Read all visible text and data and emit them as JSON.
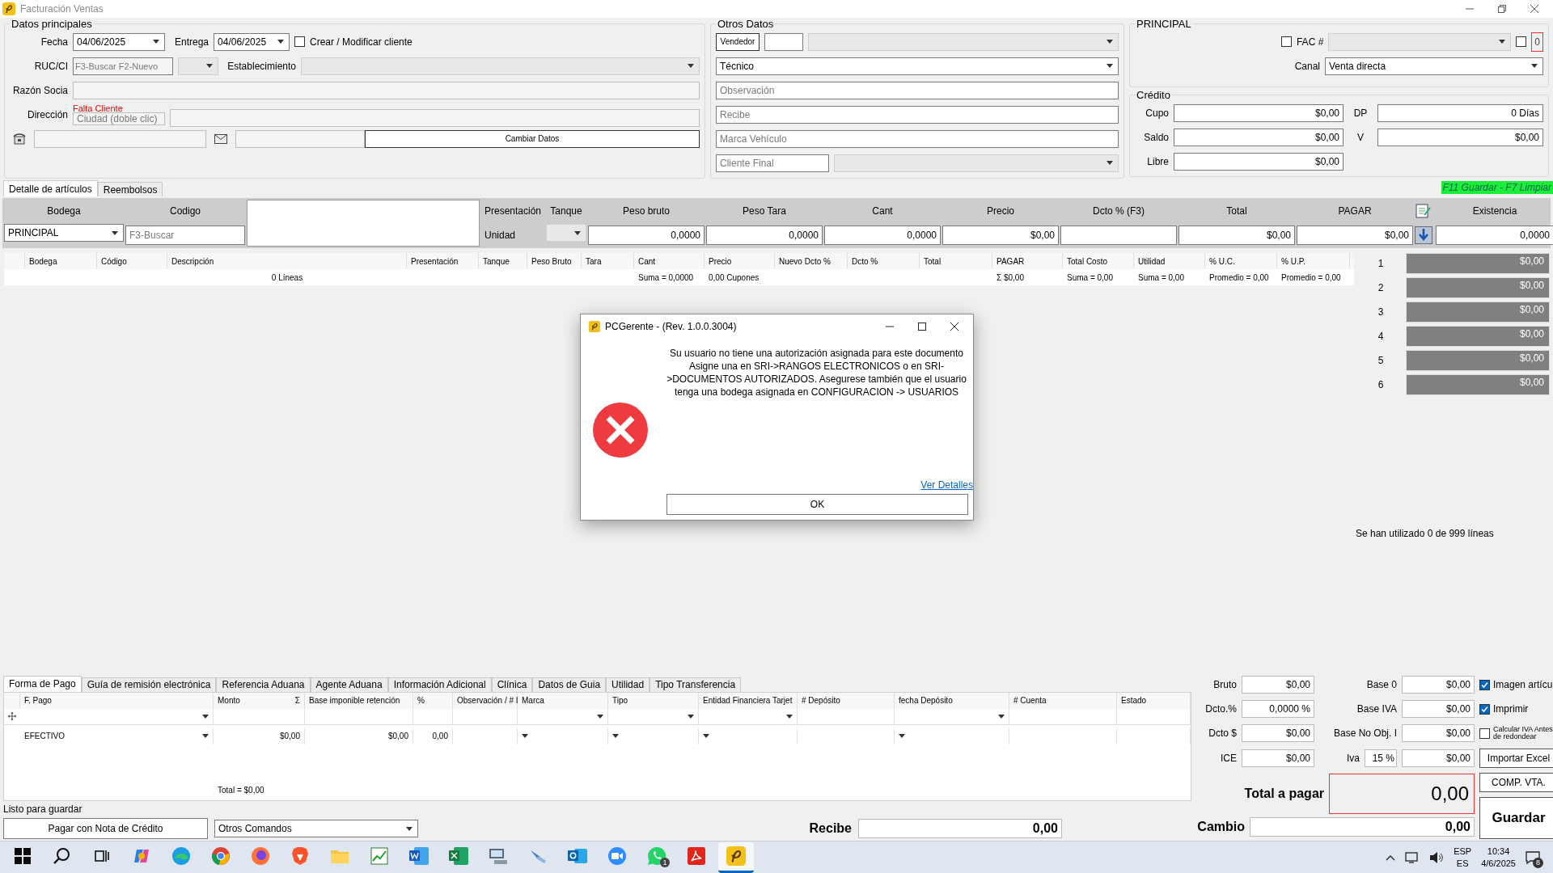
{
  "window": {
    "title": "Facturación Ventas"
  },
  "datos_principales": {
    "title": "Datos principales",
    "fecha_label": "Fecha",
    "fecha": "04/06/2025",
    "entrega_label": "Entrega",
    "entrega": "04/06/2025",
    "crear_cliente": {
      "label": "Crear / Modificar cliente",
      "checked": false
    },
    "ruc_label": "RUC/CI",
    "ruc_placeholder": "F3-Buscar F2-Nuevo",
    "establecimiento_label": "Establecimiento",
    "razon_label": "Razón Socia",
    "direccion_label": "Dirección",
    "warning": "Falta Cliente",
    "ciudad_placeholder": "Ciudad (doble clic)",
    "cambiar_button": "Cambiar Datos"
  },
  "otros_datos": {
    "title": "Otros Datos",
    "vendedor_button": "Vendedor",
    "tecnico": "Técnico",
    "observacion_placeholder": "Observación",
    "recibe_placeholder": "Recibe",
    "marca_placeholder": "Marca Vehículo",
    "cliente_final_placeholder": "Cliente Final"
  },
  "principal": {
    "title": "PRINCIPAL",
    "fac": {
      "label": "FAC #",
      "checked": false
    },
    "extra_checked": false,
    "counter": "0",
    "canal_label": "Canal",
    "canal": "Venta directa"
  },
  "credito": {
    "title": "Crédito",
    "fields": [
      {
        "label": "Cupo",
        "value": "$0,00"
      },
      {
        "label": "DP",
        "value": "0 Días"
      },
      {
        "label": "Saldo",
        "value": "$0,00"
      },
      {
        "label": "V",
        "value": "$0,00"
      },
      {
        "label": "Libre",
        "value": "$0,00"
      }
    ]
  },
  "main_tabs": [
    {
      "label": "Detalle de artículos",
      "selected": true
    },
    {
      "label": "Reembolsos",
      "selected": false
    }
  ],
  "shortcut_hint": "F11 Guardar - F7 Limpiar",
  "entry": [
    {
      "kind": "select",
      "label": "Bodega",
      "value": "PRINCIPAL"
    },
    {
      "kind": "input",
      "label": "Codigo",
      "placeholder": "F3-Buscar"
    },
    {
      "kind": "memo"
    },
    {
      "kind": "text",
      "label": "Presentación",
      "value": "Unidad"
    },
    {
      "kind": "select",
      "label": "Tanque"
    },
    {
      "kind": "input",
      "label": "Peso bruto",
      "value": "0,0000"
    },
    {
      "kind": "input",
      "label": "Peso Tara",
      "value": "0,0000"
    },
    {
      "kind": "input",
      "label": "Cant",
      "value": "0,0000"
    },
    {
      "kind": "input",
      "label": "Precio",
      "value": "$0,00"
    },
    {
      "kind": "input",
      "label": "Dcto % (F3)"
    },
    {
      "kind": "input",
      "label": "Total",
      "value": "$0,00"
    },
    {
      "kind": "input",
      "label": "PAGAR",
      "value": "$0,00"
    },
    {
      "kind": "action"
    },
    {
      "kind": "input",
      "label": "Existencia",
      "value": "0,0000"
    }
  ],
  "items_grid": {
    "columns": [
      "Bodega",
      "Código",
      "Descripción",
      "Presentación",
      "Tanque",
      "Peso Bruto",
      "Tara",
      "Cant",
      "Precio",
      "Nuevo Dcto %",
      "Dcto %",
      "Total",
      "PAGAR",
      "Total Costo",
      "Utilidad",
      "% U.C.",
      "% U.P."
    ],
    "summary": [
      "0 Líneas",
      "Suma = 0,0000",
      "0,00 Cupones",
      "Σ $0,00",
      "Suma = 0,00",
      "Suma = 0,00",
      "Promedio = 0,00",
      "Promedio = 0,00"
    ]
  },
  "price_levels": [
    {
      "number": "1",
      "value": "$0,00"
    },
    {
      "number": "2",
      "value": "$0,00"
    },
    {
      "number": "3",
      "value": "$0,00"
    },
    {
      "number": "4",
      "value": "$0,00"
    },
    {
      "number": "5",
      "value": "$0,00"
    },
    {
      "number": "6",
      "value": "$0,00"
    }
  ],
  "usage": "Se han utilizado 0 de 999 líneas",
  "dialog": {
    "title": "PCGerente - (Rev. 1.0.0.3004)",
    "message": "Su usuario no tiene una autorización asignada para este documento\nAsigne una en SRI->RANGOS ELECTRONICOS o en SRI->DOCUMENTOS AUTORIZADOS. Asegurese también que el usuario tenga una bodega asignada en CONFIGURACION -> USUARIOS",
    "link": "Ver Detalles",
    "button": "OK"
  },
  "bottom_tabs": [
    {
      "label": "Forma de Pago",
      "selected": true
    },
    {
      "label": "Guía de remisión electrónica",
      "selected": false
    },
    {
      "label": "Referencia Aduana",
      "selected": false
    },
    {
      "label": "Agente Aduana",
      "selected": false
    },
    {
      "label": "Información Adicional",
      "selected": false
    },
    {
      "label": "Clínica",
      "selected": false
    },
    {
      "label": "Datos de Guia",
      "selected": false
    },
    {
      "label": "Utilidad",
      "selected": false
    },
    {
      "label": "Tipo Transferencia",
      "selected": false
    }
  ],
  "payment_grid": {
    "columns": [
      "F. Pago",
      "Monto",
      "Base imponible retención",
      "%",
      "Observación / # I",
      "Marca",
      "Tipo",
      "Entidad Financiera Tarjet",
      "# Depósito",
      "fecha Depósito",
      "# Cuenta",
      "Estado"
    ],
    "sum_mark": "Σ",
    "rows": [
      {
        "cells": [
          "EFECTIVO",
          "$0,00",
          "$0,00",
          "0,00"
        ]
      }
    ],
    "total": "Total = $0,00"
  },
  "status": "Listo para guardar",
  "actions": {
    "nota_credito_button": "Pagar con Nota de Crédito",
    "otros_comandos": "Otros Comandos",
    "recibe_label": "Recibe",
    "recibe_value": "0,00"
  },
  "totals": {
    "rows": [
      {
        "label": "Bruto",
        "value": "$0,00",
        "label2": "Base 0",
        "value2": "$0,00"
      },
      {
        "label": "Dcto.%",
        "value": "0,0000 %",
        "label2": "Base IVA",
        "value2": "$0,00"
      },
      {
        "label": "Dcto $",
        "value": "$0,00",
        "label2": "Base No Obj. I",
        "value2": "$0,00"
      },
      {
        "label": "ICE",
        "value": "$0,00",
        "label2": "Iva",
        "rate": "15 %",
        "value2": "$0,00"
      }
    ],
    "options": [
      {
        "label": "Imagen artícu",
        "checked": true
      },
      {
        "label": "Imprimir",
        "checked": true
      },
      {
        "label": "Calcular IVA Antes de redondear",
        "checked": false
      }
    ],
    "importar_button": "Importar Excel",
    "total_label": "Total a pagar",
    "total_value": "0,00",
    "comp_button": "COMP. VTA.",
    "guardar_button": "Guardar",
    "cambio_label": "Cambio",
    "cambio_value": "0,00"
  },
  "taskbar": {
    "apps": [
      {
        "kind": "windows",
        "selected": false
      },
      {
        "kind": "search",
        "selected": false
      },
      {
        "kind": "taskview",
        "selected": false
      },
      {
        "kind": "copilot",
        "selected": false
      },
      {
        "kind": "edge",
        "selected": false
      },
      {
        "kind": "chrome",
        "selected": false
      },
      {
        "kind": "firefox",
        "selected": false
      },
      {
        "kind": "brave",
        "selected": false
      },
      {
        "kind": "folder",
        "selected": false
      },
      {
        "kind": "chart",
        "selected": false
      },
      {
        "kind": "word",
        "selected": false
      },
      {
        "kind": "excel",
        "selected": false
      },
      {
        "kind": "monitor",
        "selected": false
      },
      {
        "kind": "tool",
        "selected": false
      },
      {
        "kind": "outlook",
        "selected": false
      },
      {
        "kind": "zoom",
        "selected": false
      },
      {
        "kind": "whatsapp",
        "selected": false,
        "badge": "1"
      },
      {
        "kind": "acrobat",
        "selected": false
      },
      {
        "kind": "pcgerente",
        "selected": true
      }
    ],
    "language": "ESP",
    "layout": "ES",
    "time": "10:34",
    "date": "4/6/2025",
    "notifications": "8"
  }
}
